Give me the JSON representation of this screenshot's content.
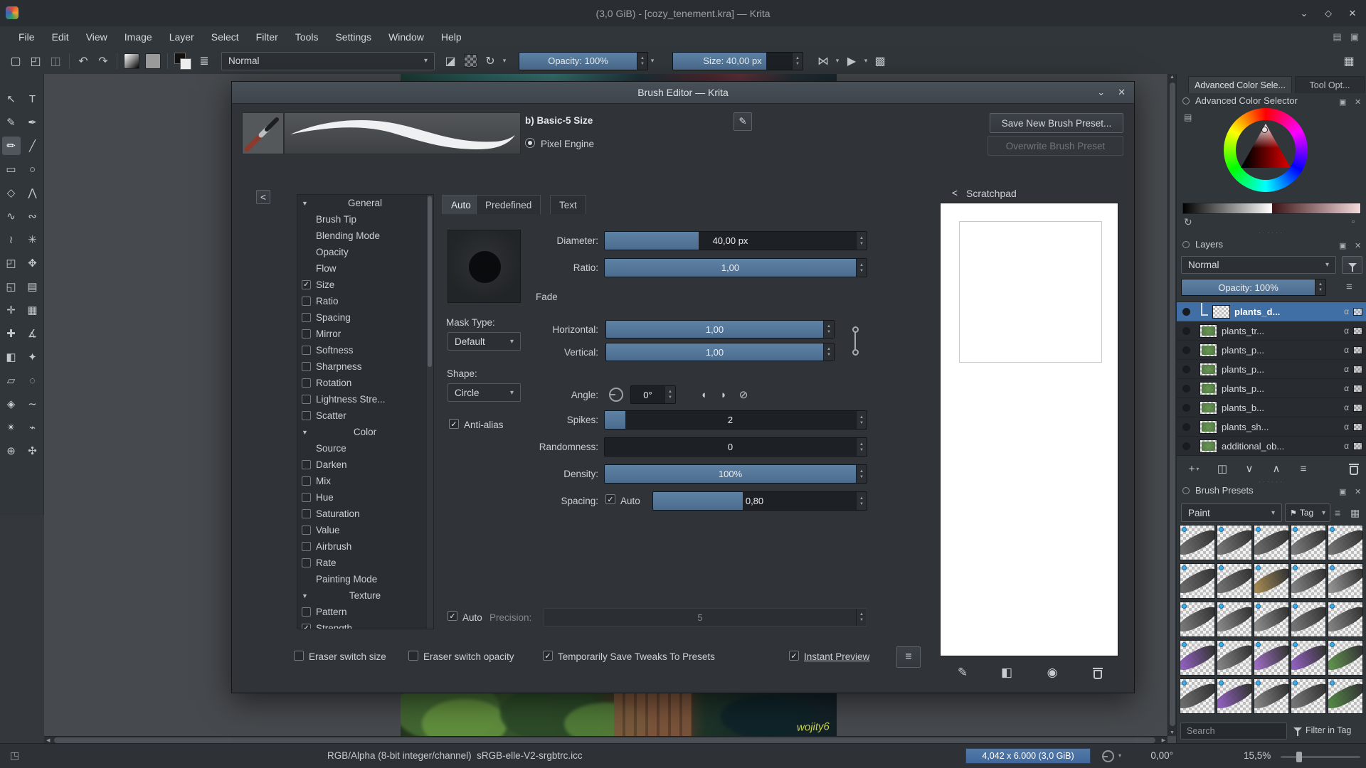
{
  "theme": {
    "bg": "#31363a",
    "bg_dark": "#26292d",
    "titlebar": "#2a2e32",
    "dialog_bg": "#303438",
    "accent_blue": "#4c6c8e",
    "selection_blue": "#3f6fa5",
    "text": "#d2d6da",
    "text_dim": "#8f969c",
    "canvas_bg": "#46494d",
    "memory_bar": "#41689c"
  },
  "window": {
    "title": "(3,0 GiB) - [cozy_tenement.kra] — Krita",
    "controls": {
      "minimize": "⌄",
      "maximize": "◇",
      "close": "✕"
    }
  },
  "menubar": {
    "items": [
      "File",
      "Edit",
      "View",
      "Image",
      "Layer",
      "Select",
      "Filter",
      "Tools",
      "Settings",
      "Window",
      "Help"
    ],
    "right_icons": [
      {
        "name": "show-canvas-only-icon",
        "glyph": "▤"
      },
      {
        "name": "workspace-chooser-icon",
        "glyph": "▣"
      }
    ]
  },
  "toolbar": {
    "blending_mode": "Normal",
    "opacity_label": "Opacity: 100%",
    "opacity_fill": 100,
    "size_label": "Size: 40,00 px",
    "size_fill": 72,
    "icons": {
      "new_document": "▢",
      "open": "◰",
      "save": "◫",
      "undo": "↶",
      "redo": "↷",
      "brush_settings": "≣",
      "eraser": "◪",
      "reload": "↻",
      "mirror_vertical": "⋈",
      "mirror_horizontal": "▶",
      "wraparound": "▩",
      "workspace": "▦"
    }
  },
  "toolbox": {
    "tools": [
      {
        "name": "select-shapes-tool",
        "glyph": "↖"
      },
      {
        "name": "text-tool",
        "glyph": "T"
      },
      {
        "name": "edit-shapes-tool",
        "glyph": "✎"
      },
      {
        "name": "calligraphy-tool",
        "glyph": "✒"
      },
      {
        "name": "freehand-brush-tool",
        "glyph": "✏",
        "active": true
      },
      {
        "name": "line-tool",
        "glyph": "╱"
      },
      {
        "name": "rectangle-tool",
        "glyph": "▭"
      },
      {
        "name": "ellipse-tool",
        "glyph": "○"
      },
      {
        "name": "polygon-tool",
        "glyph": "◇"
      },
      {
        "name": "polyline-tool",
        "glyph": "⋀"
      },
      {
        "name": "bezier-curve-tool",
        "glyph": "∿"
      },
      {
        "name": "freehand-path-tool",
        "glyph": "∾"
      },
      {
        "name": "dynamic-brush-tool",
        "glyph": "≀"
      },
      {
        "name": "multibrush-tool",
        "glyph": "✳"
      },
      {
        "name": "transform-tool",
        "glyph": "◰"
      },
      {
        "name": "move-tool",
        "glyph": "✥"
      },
      {
        "name": "crop-tool",
        "glyph": "◱"
      },
      {
        "name": "gradient-tool",
        "glyph": "▤"
      },
      {
        "name": "color-sampler-tool",
        "glyph": "✛"
      },
      {
        "name": "pattern-edit-tool",
        "glyph": "▦"
      },
      {
        "name": "smart-patch-tool",
        "glyph": "✚"
      },
      {
        "name": "measure-tool",
        "glyph": "∡"
      },
      {
        "name": "fill-tool",
        "glyph": "◧"
      },
      {
        "name": "assistants-tool",
        "glyph": "✦"
      },
      {
        "name": "rectangular-select-tool",
        "glyph": "▱"
      },
      {
        "name": "elliptical-select-tool",
        "glyph": "◌"
      },
      {
        "name": "polygonal-select-tool",
        "glyph": "◈"
      },
      {
        "name": "freehand-select-tool",
        "glyph": "∼"
      },
      {
        "name": "similar-color-select-tool",
        "glyph": "✴"
      },
      {
        "name": "magnetic-select-tool",
        "glyph": "⌁"
      },
      {
        "name": "zoom-tool",
        "glyph": "⊕"
      },
      {
        "name": "pan-tool",
        "glyph": "✣"
      }
    ]
  },
  "canvas": {
    "signature": "wojity6"
  },
  "dialog": {
    "title": "Brush Editor — Krita",
    "controls": {
      "shade": "⌄",
      "close": "✕"
    },
    "collapse_icon": "<",
    "preset_name": "b) Basic-5 Size",
    "edit_icon": "✎",
    "engine_label": "Pixel Engine",
    "save_button": "Save New Brush Preset...",
    "overwrite_button": "Overwrite Brush Preset",
    "tabs": [
      "Auto",
      "Predefined",
      "Text"
    ],
    "active_tab": "Auto",
    "options": [
      {
        "label": "General",
        "type": "section"
      },
      {
        "label": "Brush Tip",
        "type": "plain"
      },
      {
        "label": "Blending Mode",
        "type": "plain"
      },
      {
        "label": "Opacity",
        "type": "plain"
      },
      {
        "label": "Flow",
        "type": "plain"
      },
      {
        "label": "Size",
        "type": "check",
        "checked": true
      },
      {
        "label": "Ratio",
        "type": "check",
        "checked": false
      },
      {
        "label": "Spacing",
        "type": "check",
        "checked": false
      },
      {
        "label": "Mirror",
        "type": "check",
        "checked": false
      },
      {
        "label": "Softness",
        "type": "check",
        "checked": false
      },
      {
        "label": "Sharpness",
        "type": "check",
        "checked": false
      },
      {
        "label": "Rotation",
        "type": "check",
        "checked": false
      },
      {
        "label": "Lightness Stre...",
        "type": "check",
        "checked": false
      },
      {
        "label": "Scatter",
        "type": "check",
        "checked": false
      },
      {
        "label": "Color",
        "type": "section"
      },
      {
        "label": "Source",
        "type": "plain"
      },
      {
        "label": "Darken",
        "type": "check",
        "checked": false
      },
      {
        "label": "Mix",
        "type": "check",
        "checked": false
      },
      {
        "label": "Hue",
        "type": "check",
        "checked": false
      },
      {
        "label": "Saturation",
        "type": "check",
        "checked": false
      },
      {
        "label": "Value",
        "type": "check",
        "checked": false
      },
      {
        "label": "Airbrush",
        "type": "check",
        "checked": false
      },
      {
        "label": "Rate",
        "type": "check",
        "checked": false
      },
      {
        "label": "Painting Mode",
        "type": "plain"
      },
      {
        "label": "Texture",
        "type": "section"
      },
      {
        "label": "Pattern",
        "type": "check",
        "checked": false
      },
      {
        "label": "Strength",
        "type": "check",
        "checked": true
      }
    ],
    "fields": {
      "diameter_label": "Diameter:",
      "diameter_value": "40,00 px",
      "diameter_fill": 36,
      "ratio_label": "Ratio:",
      "ratio_value": "1,00",
      "ratio_fill": 100,
      "fade_label": "Fade",
      "mask_type_label": "Mask Type:",
      "mask_type_value": "Default",
      "horizontal_label": "Horizontal:",
      "horizontal_value": "1,00",
      "horizontal_fill": 100,
      "vertical_label": "Vertical:",
      "vertical_value": "1,00",
      "vertical_fill": 100,
      "shape_label": "Shape:",
      "shape_value": "Circle",
      "angle_label": "Angle:",
      "angle_value": "0°",
      "angle_icons": [
        "◖",
        "◗",
        "⊘"
      ],
      "antialias_label": "Anti-alias",
      "antialias_checked": true,
      "spikes_label": "Spikes:",
      "spikes_value": "2",
      "spikes_fill": 8,
      "randomness_label": "Randomness:",
      "randomness_value": "0",
      "randomness_fill": 0,
      "density_label": "Density:",
      "density_value": "100%",
      "density_fill": 100,
      "spacing_label": "Spacing:",
      "spacing_auto_label": "Auto",
      "spacing_auto_checked": true,
      "spacing_value": "0,80",
      "spacing_fill": 42,
      "auto_label": "Auto",
      "auto_checked": true,
      "precision_label": "Precision:",
      "precision_value": "5",
      "precision_fill": 0
    },
    "footer": {
      "eraser_switch_size_label": "Eraser switch size",
      "eraser_switch_size_checked": false,
      "eraser_switch_opacity_label": "Eraser switch opacity",
      "eraser_switch_opacity_checked": false,
      "save_tweaks_label": "Temporarily Save Tweaks To Presets",
      "save_tweaks_checked": true,
      "instant_preview_label": "Instant Preview",
      "instant_preview_checked": true,
      "menu_icon": "≡"
    },
    "scratchpad": {
      "title": "Scratchpad",
      "collapse_icon": "<",
      "icons": [
        {
          "name": "scratchpad-paint-button",
          "glyph": "✎"
        },
        {
          "name": "scratchpad-fill-gradient-button",
          "glyph": "◧"
        },
        {
          "name": "scratchpad-fill-color-button",
          "glyph": "◉"
        }
      ]
    }
  },
  "right_panel": {
    "tabs": [
      {
        "label": "Advanced Color Sele...",
        "active": true
      },
      {
        "label": "Tool Opt...",
        "active": false
      }
    ],
    "docker_icons": {
      "float": "▣",
      "close": "✕"
    },
    "color_selector": {
      "title": "Advanced Color Selector",
      "list_icon": "▤",
      "refresh_icon": "↻",
      "settings_icon": "▫"
    },
    "layers": {
      "title": "Layers",
      "blending_mode": "Normal",
      "opacity_label": "Opacity: 100%",
      "opacity_fill": 100,
      "menu_icon": "≡",
      "rows": [
        {
          "name": "plants_d...",
          "selected": true
        },
        {
          "name": "plants_tr...",
          "selected": false
        },
        {
          "name": "plants_p...",
          "selected": false
        },
        {
          "name": "plants_p...",
          "selected": false
        },
        {
          "name": "plants_p...",
          "selected": false
        },
        {
          "name": "plants_b...",
          "selected": false
        },
        {
          "name": "plants_sh...",
          "selected": false
        },
        {
          "name": "additional_ob...",
          "selected": false
        }
      ],
      "action_icons": [
        {
          "name": "add-layer-button",
          "glyph": "+"
        },
        {
          "name": "duplicate-layer-button",
          "glyph": "◫"
        },
        {
          "name": "move-layer-down-button",
          "glyph": "∨"
        },
        {
          "name": "move-layer-up-button",
          "glyph": "∧"
        },
        {
          "name": "layer-properties-button",
          "glyph": "≡"
        }
      ]
    },
    "brush_presets": {
      "title": "Brush Presets",
      "tag_filter": "Paint",
      "tag_icon": "⚑",
      "tag_button": "Tag",
      "view_icons": [
        {
          "name": "preset-view-mode-button",
          "glyph": "≡"
        },
        {
          "name": "preset-display-button",
          "glyph": "▦"
        }
      ],
      "search_placeholder": "Search",
      "filter_label": "Filter in Tag",
      "cells": [
        {
          "tint": "#707070"
        },
        {
          "tint": "#7a7a7a"
        },
        {
          "tint": "#6c6c6c"
        },
        {
          "tint": "#828282"
        },
        {
          "tint": "#767676"
        },
        {
          "tint": "#6b6b6b"
        },
        {
          "tint": "#757575"
        },
        {
          "tint": "#b3924f"
        },
        {
          "tint": "#8a8a8a"
        },
        {
          "tint": "#9e9e9e"
        },
        {
          "tint": "#7c7c7c"
        },
        {
          "tint": "#8f8f8f"
        },
        {
          "tint": "#969696"
        },
        {
          "tint": "#7a7a7a"
        },
        {
          "tint": "#888888"
        },
        {
          "tint": "#9a5fd0"
        },
        {
          "tint": "#8a8a8a"
        },
        {
          "tint": "#a96fd4"
        },
        {
          "tint": "#9a5fd0"
        },
        {
          "tint": "#5f9c4a"
        },
        {
          "tint": "#6e6e6e"
        },
        {
          "tint": "#9a5fd0"
        },
        {
          "tint": "#8a8a8a"
        },
        {
          "tint": "#7a7a7a"
        },
        {
          "tint": "#4f8f3f"
        }
      ]
    }
  },
  "statusbar": {
    "left_icon": "◳",
    "colorspace": "RGB/Alpha (8-bit integer/channel)  sRGB-elle-V2-srgbtrc.icc",
    "memory": "4,042 x 6.000 (3,0 GiB)",
    "angle": "0,00°",
    "zoom": "15,5%",
    "zoom_fill": 20
  }
}
